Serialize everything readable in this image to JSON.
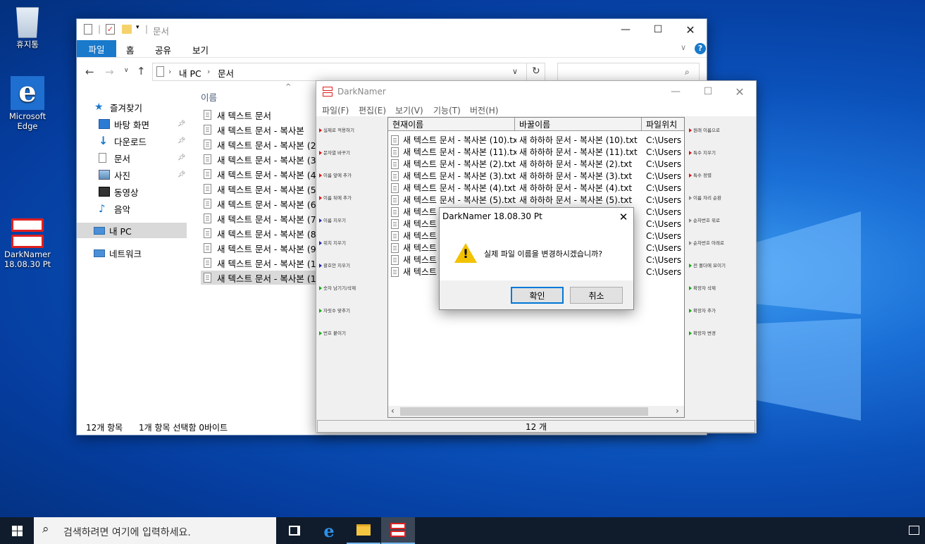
{
  "desktop": {
    "icons": [
      {
        "label": "휴지통"
      },
      {
        "label": "Microsoft\nEdge"
      },
      {
        "label": "DarkNamer\n18.08.30 Pt"
      }
    ]
  },
  "explorer": {
    "title": "문서",
    "ribbon_tabs": [
      "파일",
      "홈",
      "공유",
      "보기"
    ],
    "breadcrumb": [
      "내 PC",
      "문서"
    ],
    "column_header": "이름",
    "nav": {
      "quick_access": "즐겨찾기",
      "items": [
        "바탕 화면",
        "다운로드",
        "문서",
        "사진",
        "동영상",
        "음악"
      ],
      "this_pc": "내 PC",
      "network": "네트워크"
    },
    "files": [
      "새 텍스트 문서",
      "새 텍스트 문서 - 복사본",
      "새 텍스트 문서 - 복사본 (2",
      "새 텍스트 문서 - 복사본 (3",
      "새 텍스트 문서 - 복사본 (4",
      "새 텍스트 문서 - 복사본 (5",
      "새 텍스트 문서 - 복사본 (6",
      "새 텍스트 문서 - 복사본 (7",
      "새 텍스트 문서 - 복사본 (8",
      "새 텍스트 문서 - 복사본 (9",
      "새 텍스트 문서 - 복사본 (1",
      "새 텍스트 문서 - 복사본 (1"
    ],
    "status_count": "12개 항목",
    "status_selected": "1개 항목 선택함 0바이트"
  },
  "darknamer": {
    "title": "DarkNamer",
    "menu": [
      "파일(F)",
      "편집(E)",
      "보기(V)",
      "기능(T)",
      "버전(H)"
    ],
    "left_tools": [
      "실제로 적용하기",
      "문자열 바꾸기",
      "이름 앞에 추가",
      "이름 뒤에 추가",
      "이름 지우기",
      "위치 지우기",
      "괄호안 지우기",
      "숫자 남기기/삭제",
      "자릿수 맞추기",
      "번호 붙이기"
    ],
    "right_tools": [
      "원래 이름으로",
      "특수 지우기",
      "특수 정렬",
      "이름 자리 순환",
      "순차번호 위로",
      "순차번호 아래로",
      "전 폴더에 묘이기",
      "확장자 삭제",
      "확장자 추가",
      "확장자 변경"
    ],
    "columns": [
      "현재이름",
      "바꿀이름",
      "파일위치"
    ],
    "rows": [
      {
        "current": "새 텍스트 문서 - 복사본 (10).txt",
        "new": "새 하하하 문서 - 복사본 (10).txt",
        "path": "C:\\Users"
      },
      {
        "current": "새 텍스트 문서 - 복사본 (11).txt",
        "new": "새 하하하 문서 - 복사본 (11).txt",
        "path": "C:\\Users"
      },
      {
        "current": "새 텍스트 문서 - 복사본 (2).txt",
        "new": "새 하하하 문서 - 복사본 (2).txt",
        "path": "C:\\Users"
      },
      {
        "current": "새 텍스트 문서 - 복사본 (3).txt",
        "new": "새 하하하 문서 - 복사본 (3).txt",
        "path": "C:\\Users"
      },
      {
        "current": "새 텍스트 문서 - 복사본 (4).txt",
        "new": "새 하하하 문서 - 복사본 (4).txt",
        "path": "C:\\Users"
      },
      {
        "current": "새 텍스트 문서 - 복사본 (5).txt",
        "new": "새 하하하 문서 - 복사본 (5).txt",
        "path": "C:\\Users"
      },
      {
        "current": "새 텍스트",
        "new": "",
        "path": "C:\\Users"
      },
      {
        "current": "새 텍스트",
        "new": "",
        "path": "C:\\Users"
      },
      {
        "current": "새 텍스트",
        "new": "",
        "path": "C:\\Users"
      },
      {
        "current": "새 텍스트",
        "new": "",
        "path": "C:\\Users"
      },
      {
        "current": "새 텍스트",
        "new": "",
        "path": "C:\\Users"
      },
      {
        "current": "새 텍스트",
        "new": "",
        "path": "C:\\Users"
      }
    ],
    "status": "12 개"
  },
  "dialog": {
    "title": "DarkNamer 18.08.30 Pt",
    "message": "실제 파일 이름을 변경하시겠습니까?",
    "ok": "확인",
    "cancel": "취소"
  },
  "taskbar": {
    "search_placeholder": "검색하려면 여기에 입력하세요."
  },
  "colors": {
    "accent": "#1979ca",
    "selection": "#cce8ff",
    "taskbar": "#101c2c"
  }
}
